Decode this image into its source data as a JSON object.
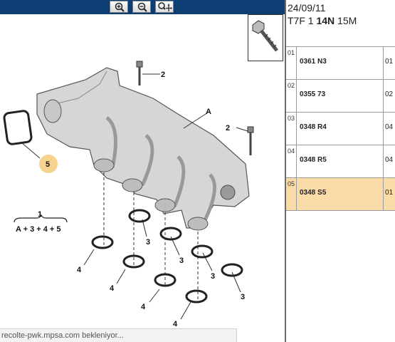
{
  "toolbar": {
    "zoom_in_icon": "magnifier-plus-icon",
    "zoom_out_icon": "magnifier-minus-icon",
    "zoom_fit_icon": "magnifier-move-icon"
  },
  "header": {
    "date": "24/09/11",
    "code_prefix": "T7F 1 ",
    "code_bold": "14N",
    "code_suffix": " 15M"
  },
  "diagram": {
    "callouts": {
      "a": "A",
      "two_top": "2",
      "two_right": "2",
      "five": "5",
      "one": "1",
      "formula": "A + 3 + 4 + 5",
      "three_1": "3",
      "three_2": "3",
      "three_3": "3",
      "three_4": "3",
      "four_1": "4",
      "four_2": "4",
      "four_3": "4",
      "four_4": "4"
    }
  },
  "parts": [
    {
      "index": "01",
      "ref": "0361 N3",
      "qty": "01",
      "selected": false
    },
    {
      "index": "02",
      "ref": "0355 73",
      "qty": "02",
      "selected": false
    },
    {
      "index": "03",
      "ref": "0348 R4",
      "qty": "04",
      "selected": false
    },
    {
      "index": "04",
      "ref": "0348 R5",
      "qty": "04",
      "selected": false
    },
    {
      "index": "05",
      "ref": "0348 S5",
      "qty": "01",
      "selected": true
    }
  ],
  "status": {
    "text": "recolte-pwk.mpsa.com bekleniyor..."
  },
  "colors": {
    "toolbar_bg": "#0c3d73",
    "selected_row": "#fbdca9",
    "highlight_circle": "#f6d28f"
  }
}
